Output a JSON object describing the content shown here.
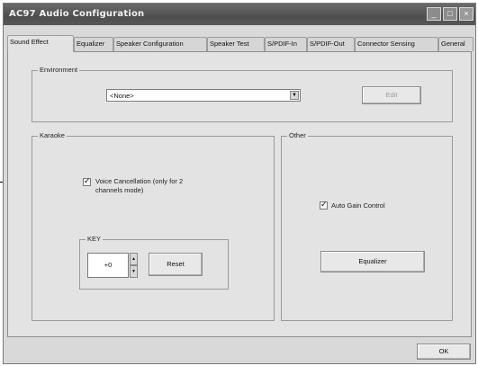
{
  "window": {
    "title": "AC97 Audio Configuration"
  },
  "tabs": [
    "Sound Effect",
    "Equalizer",
    "Speaker Configuration",
    "Speaker Test",
    "S/PDIF-In",
    "S/PDIF-Out",
    "Connector Sensing",
    "General"
  ],
  "environment": {
    "group_label": "Environment",
    "select_value": "<None>",
    "edit_label": "Edit"
  },
  "karaoke": {
    "group_label": "Karaoke",
    "voice_cancellation": {
      "checked": true,
      "label_line1": "Voice Cancellation (only for 2",
      "label_line2": "channels mode)"
    },
    "key": {
      "label": "KEY",
      "value": "+0",
      "reset_label": "Reset"
    }
  },
  "other": {
    "group_label": "Other",
    "auto_gain": {
      "checked": true,
      "label": "Auto Gain Control"
    },
    "equalizer_button": "Equalizer"
  },
  "footer": {
    "ok_label": "OK"
  }
}
